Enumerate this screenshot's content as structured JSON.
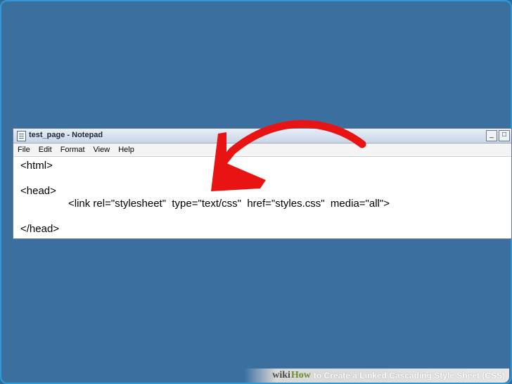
{
  "window": {
    "title": "test_page - Notepad",
    "controls": {
      "minimize": "_",
      "maximize": "□"
    }
  },
  "menubar": {
    "items": [
      "File",
      "Edit",
      "Format",
      "View",
      "Help"
    ]
  },
  "editor": {
    "lines": [
      "<html>",
      "",
      "<head>",
      "<link rel=\"stylesheet\"  type=\"text/css\"  href=\"styles.css\"  media=\"all\">",
      "",
      "</head>"
    ]
  },
  "annotation": {
    "arrow_color": "#e81313"
  },
  "banner": {
    "brand_wiki": "wiki",
    "brand_how": "How",
    "text": "to Create a Linked Cascading Style Sheet (CSS)"
  }
}
